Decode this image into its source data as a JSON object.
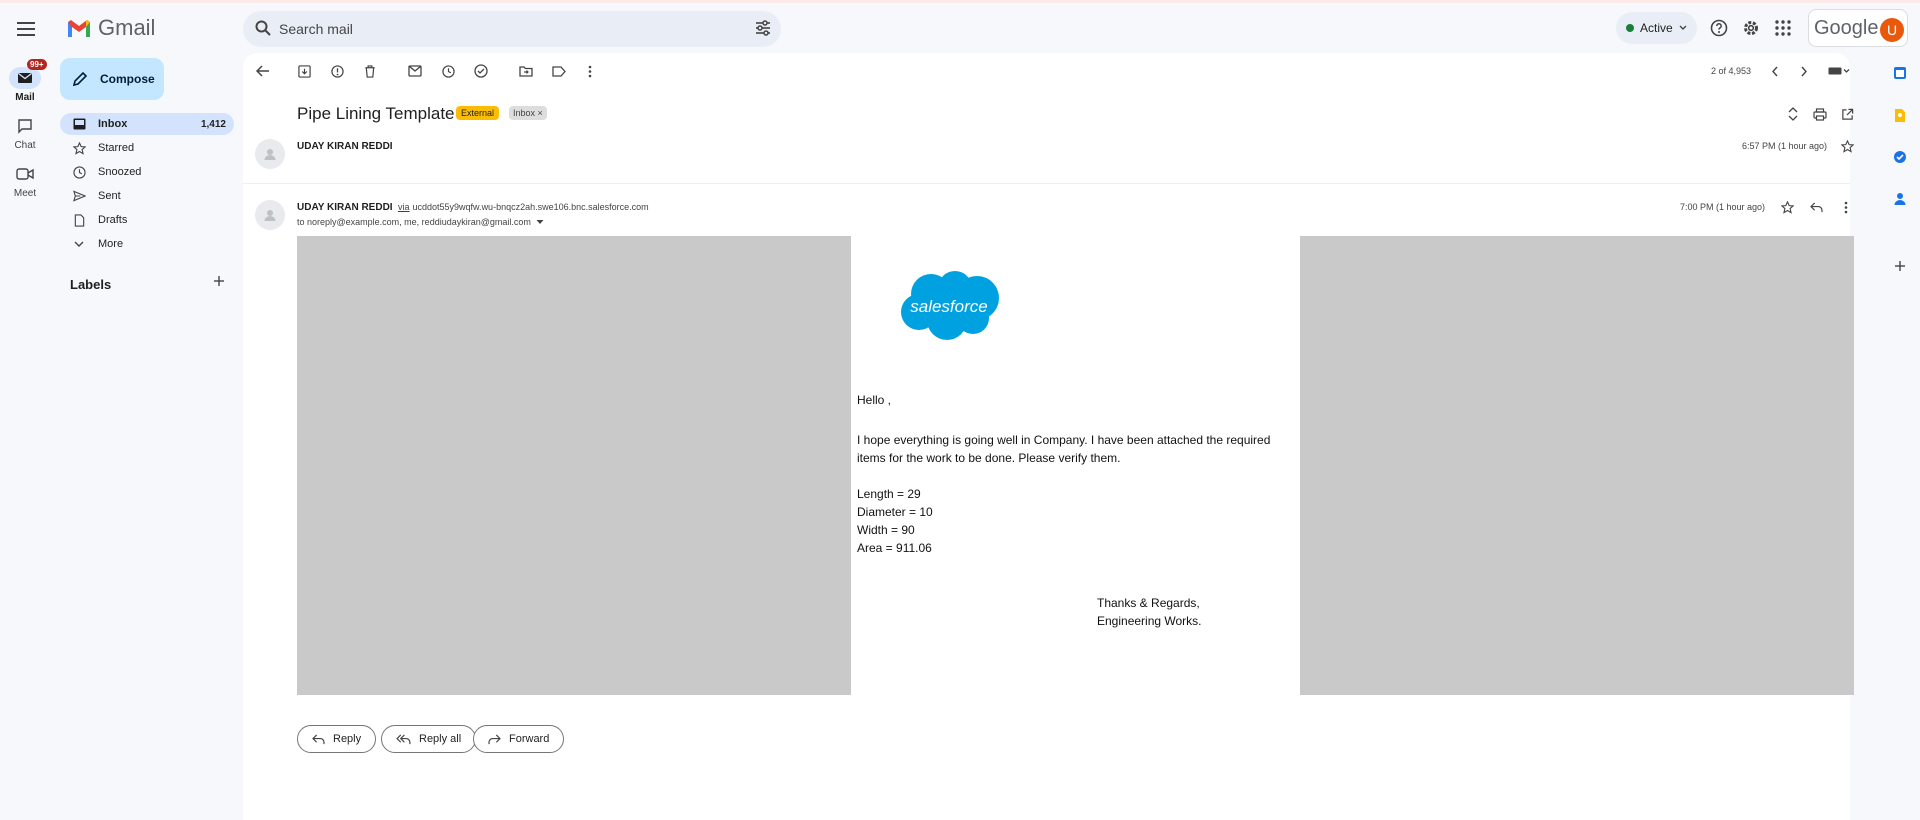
{
  "app": {
    "name": "Gmail"
  },
  "search": {
    "placeholder": "Search mail"
  },
  "status": {
    "label": "Active",
    "color": "#188038"
  },
  "google": {
    "word": "Google",
    "avatar_letter": "U",
    "avatar_color": "#e8590c"
  },
  "rail": {
    "mail": {
      "label": "Mail",
      "badge": "99+"
    },
    "chat": {
      "label": "Chat"
    },
    "meet": {
      "label": "Meet"
    }
  },
  "compose": {
    "label": "Compose"
  },
  "nav": [
    {
      "label": "Inbox",
      "count": "1,412",
      "icon": "inbox-icon"
    },
    {
      "label": "Starred",
      "count": "",
      "icon": "star-icon"
    },
    {
      "label": "Snoozed",
      "count": "",
      "icon": "clock-icon"
    },
    {
      "label": "Sent",
      "count": "",
      "icon": "send-icon"
    },
    {
      "label": "Drafts",
      "count": "",
      "icon": "draft-icon"
    },
    {
      "label": "More",
      "count": "",
      "icon": "chevron-down-icon"
    }
  ],
  "labels": {
    "heading": "Labels"
  },
  "pager": {
    "text": "2 of 4,953"
  },
  "email": {
    "subject": "Pipe Lining Template",
    "tag_external": "External",
    "tag_inbox": "Inbox",
    "tag_inbox_close": "×",
    "collapsed": {
      "sender": "UDAY KIRAN REDDI",
      "time": "6:57 PM (1 hour ago)"
    },
    "expanded": {
      "sender": "UDAY KIRAN REDDI",
      "via_word": "via",
      "via_address": "ucddot55y9wqfw.wu-bnqcz2ah.swe106.bnc.salesforce.com",
      "to": "to noreply@example.com, me, reddiudaykiran@gmail.com",
      "time": "7:00 PM (1 hour ago)"
    },
    "body": {
      "logo_text": "salesforce",
      "logo_color": "#00a1e0",
      "greeting": "Hello ,",
      "para1": "I hope everything is going well in Company. I have been attached the required items for the work to be done. Please verify them.",
      "length": "Length = 29",
      "diameter": "Diameter = 10",
      "width": "Width = 90",
      "area": "Area = 911.06",
      "thanks": "Thanks & Regards,",
      "org": "Engineering Works."
    }
  },
  "actions": {
    "reply": "Reply",
    "reply_all": "Reply all",
    "forward": "Forward"
  }
}
